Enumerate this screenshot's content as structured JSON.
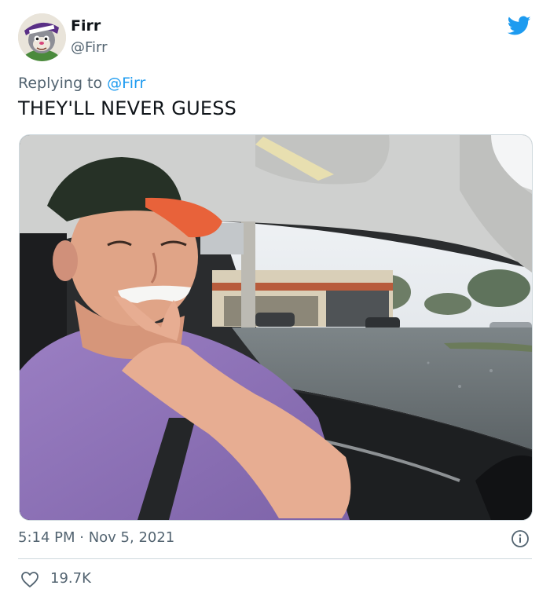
{
  "author": {
    "display_name": "Firr",
    "handle": "@Firr"
  },
  "reply": {
    "prefix": "Replying to ",
    "handle": "@Firr"
  },
  "tweet": {
    "text": "THEY'LL NEVER GUESS"
  },
  "meta": {
    "time": "5:14 PM",
    "separator": " · ",
    "date": "Nov 5, 2021"
  },
  "stats": {
    "likes": "19.7K"
  },
  "colors": {
    "brand": "#1d9bf0",
    "secondary_text": "#536471",
    "divider": "#cfd9de"
  },
  "icons": {
    "logo": "twitter-bird-icon",
    "info": "info-icon",
    "like": "heart-outline-icon"
  }
}
